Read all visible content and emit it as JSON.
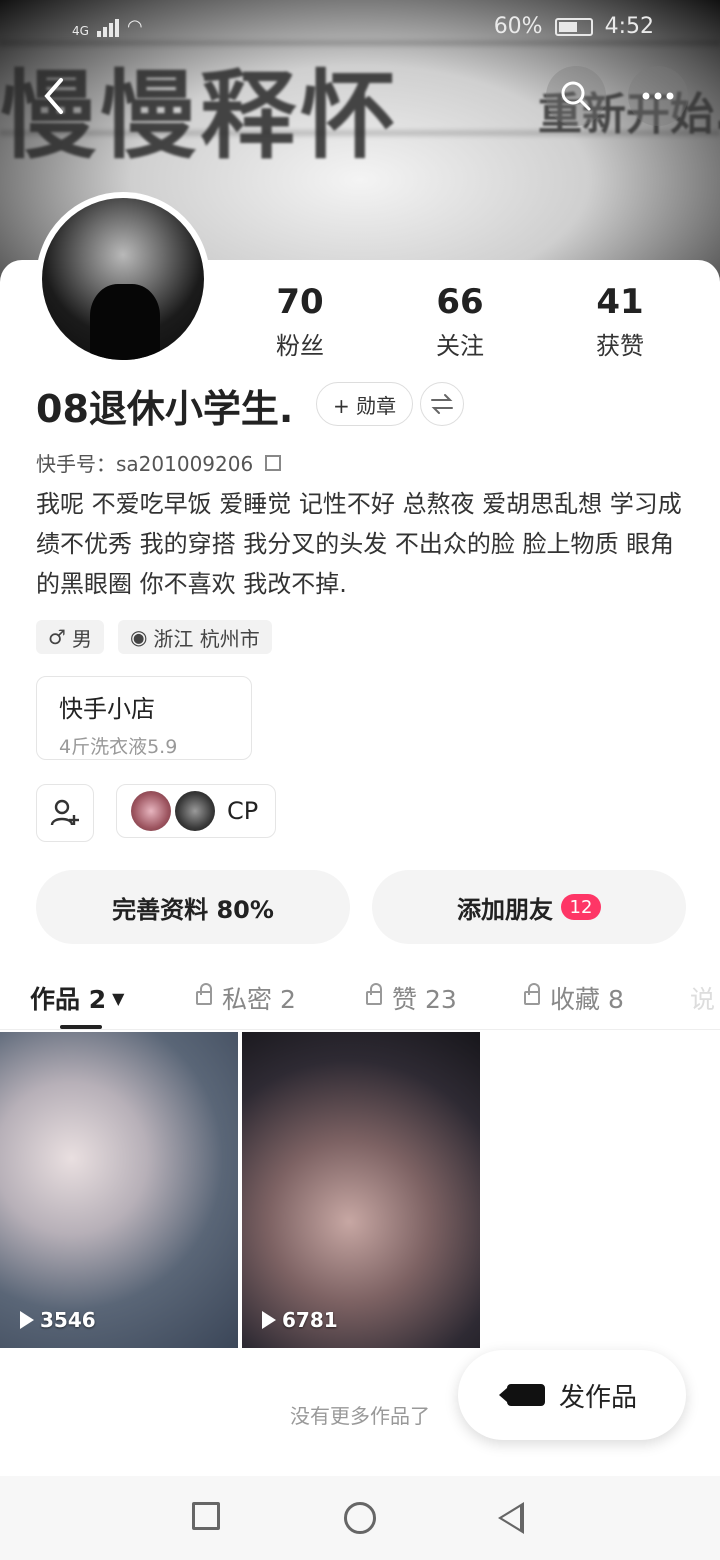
{
  "status_bar": {
    "network": "4G",
    "battery_text": "60%",
    "battery_level": 0.6,
    "time": "4:52"
  },
  "banner": {
    "text_main": "慢慢释怀",
    "text_sub": "重新开始."
  },
  "profile": {
    "stats": [
      {
        "value": "70",
        "label": "粉丝"
      },
      {
        "value": "66",
        "label": "关注"
      },
      {
        "value": "41",
        "label": "获赞"
      }
    ],
    "name": "08退休小学生.",
    "badge_label": "+ 勋章",
    "kuaishou_id": "快手号：sa201009206",
    "bio": "我呢 不爱吃早饭 爱睡觉 记性不好 总熬夜 爱胡思乱想 学习成绩不优秀  我的穿搭   我分叉的头发  不出众的脸   脸上物质  眼角的黑眼圈   你不喜欢   我改不掉.",
    "tags": [
      {
        "icon": "male-icon",
        "text": "男"
      },
      {
        "icon": "location-icon",
        "text": "浙江 杭州市"
      }
    ]
  },
  "shop": {
    "title": "快手小店",
    "subtitle": "4斤洗衣液5.9"
  },
  "cp": {
    "label": "CP"
  },
  "buttons": {
    "complete_profile": "完善资料 80%",
    "add_friends": "添加朋友",
    "add_friends_count": "12"
  },
  "tabs": [
    {
      "label": "作品 2",
      "locked": false,
      "active": true
    },
    {
      "label": "私密 2",
      "locked": true,
      "active": false
    },
    {
      "label": "赞 23",
      "locked": true,
      "active": false
    },
    {
      "label": "收藏 8",
      "locked": true,
      "active": false
    },
    {
      "label": "说",
      "locked": false,
      "active": false
    }
  ],
  "works": [
    {
      "plays": "3546"
    },
    {
      "plays": "6781"
    }
  ],
  "footer": {
    "no_more": "没有更多作品了",
    "publish": "发作品"
  },
  "colors": {
    "accent": "#fe3666"
  }
}
